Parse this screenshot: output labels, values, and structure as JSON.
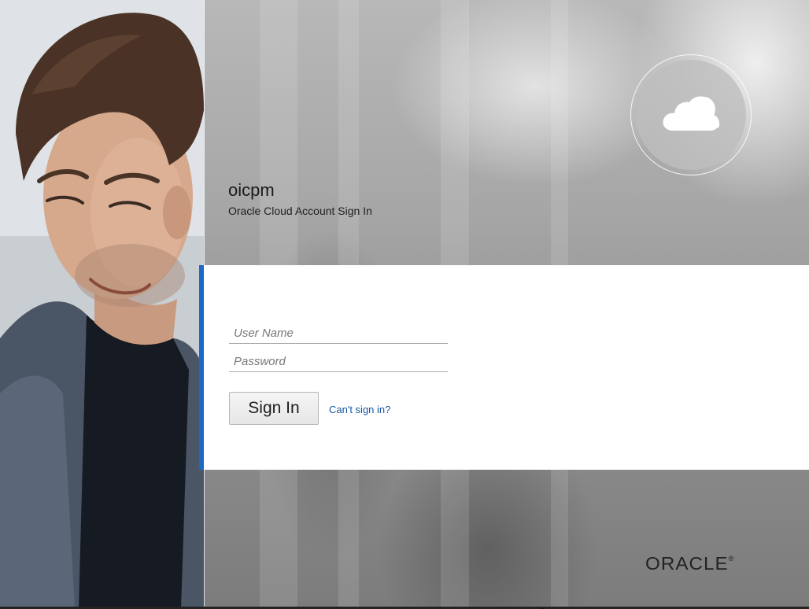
{
  "header": {
    "title": "oicpm",
    "subtitle": "Oracle Cloud Account Sign In"
  },
  "badge": {
    "icon": "cloud-icon"
  },
  "form": {
    "username_placeholder": "User Name",
    "username_value": "",
    "password_placeholder": "Password",
    "password_value": "",
    "signin_label": "Sign In",
    "help_link_label": "Can't sign in?"
  },
  "footer": {
    "logo_text": "ORACLE",
    "logo_mark": "®"
  },
  "colors": {
    "accent": "#1b6ac9",
    "link": "#1458a6",
    "panel": "#ffffff"
  }
}
